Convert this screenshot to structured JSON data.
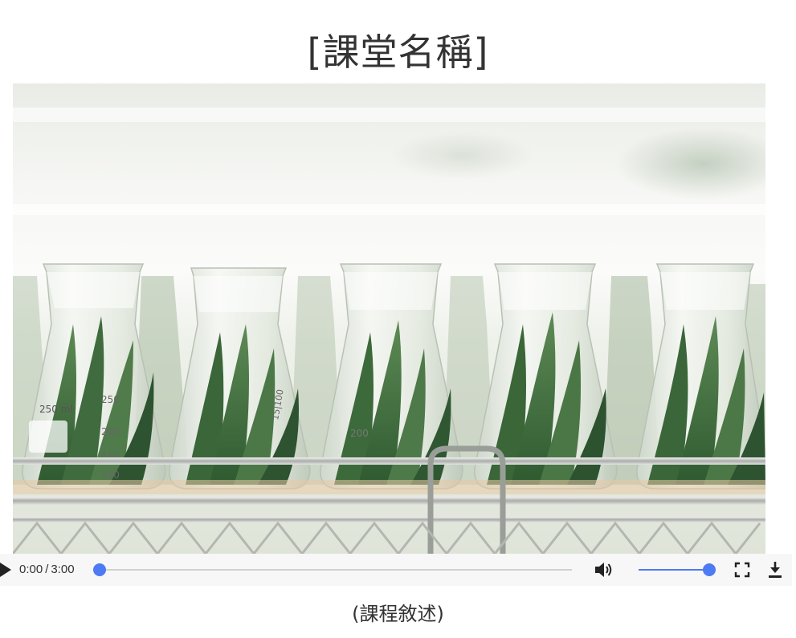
{
  "course": {
    "title": "[課堂名稱]",
    "description": "(課程敘述)"
  },
  "video": {
    "current_time": "0:00",
    "separator": "/",
    "duration": "3:00",
    "progress": 0,
    "volume": 1,
    "accent_color": "#4d7bf3"
  },
  "icons": {
    "play": "play-icon",
    "volume": "volume-icon",
    "fullscreen": "fullscreen-icon",
    "download": "download-icon"
  }
}
